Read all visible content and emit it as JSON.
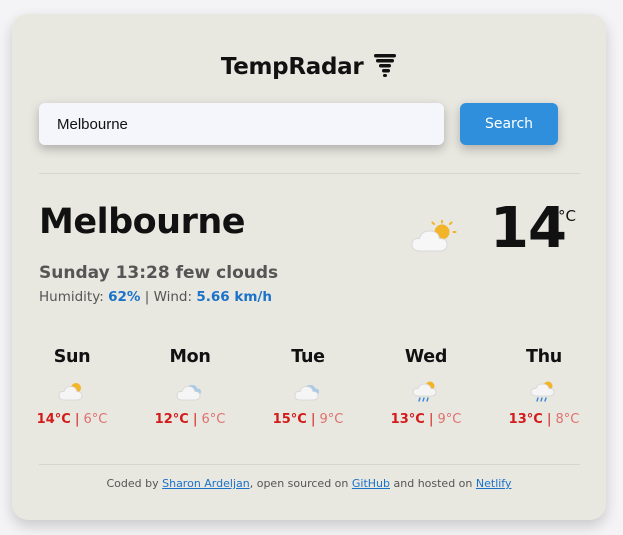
{
  "header": {
    "app_name": "TempRadar",
    "logo_icon": "tornado-icon"
  },
  "search": {
    "value": "Melbourne",
    "button_label": "Search"
  },
  "current": {
    "city": "Melbourne",
    "day_time": "Sunday 13:28",
    "description": "few clouds",
    "humidity_label": "Humidity:",
    "humidity_value": "62%",
    "separator": "|",
    "wind_label": "Wind:",
    "wind_value": "5.66 km/h",
    "icon": "partly-cloudy-icon",
    "temperature": "14",
    "unit": "°C"
  },
  "forecast": [
    {
      "day": "Sun",
      "icon": "partly-cloudy-icon",
      "max": "14°C",
      "min": "6°C"
    },
    {
      "day": "Mon",
      "icon": "cloud-icon",
      "max": "12°C",
      "min": "6°C"
    },
    {
      "day": "Tue",
      "icon": "cloud-icon",
      "max": "15°C",
      "min": "9°C"
    },
    {
      "day": "Wed",
      "icon": "rain-icon",
      "max": "13°C",
      "min": "9°C"
    },
    {
      "day": "Thu",
      "icon": "rain-icon",
      "max": "13°C",
      "min": "8°C"
    }
  ],
  "footer": {
    "prefix": "Coded by",
    "author": "Sharon Ardeljan",
    "mid1": ", open sourced on",
    "github": "GitHub",
    "mid2": "and hosted on",
    "host": "Netlify"
  },
  "colors": {
    "card_bg": "#e8e7e0",
    "accent": "#2f8fdc",
    "link": "#1a72c9",
    "max_temp": "#d41b1b",
    "min_temp": "#e0706e"
  }
}
